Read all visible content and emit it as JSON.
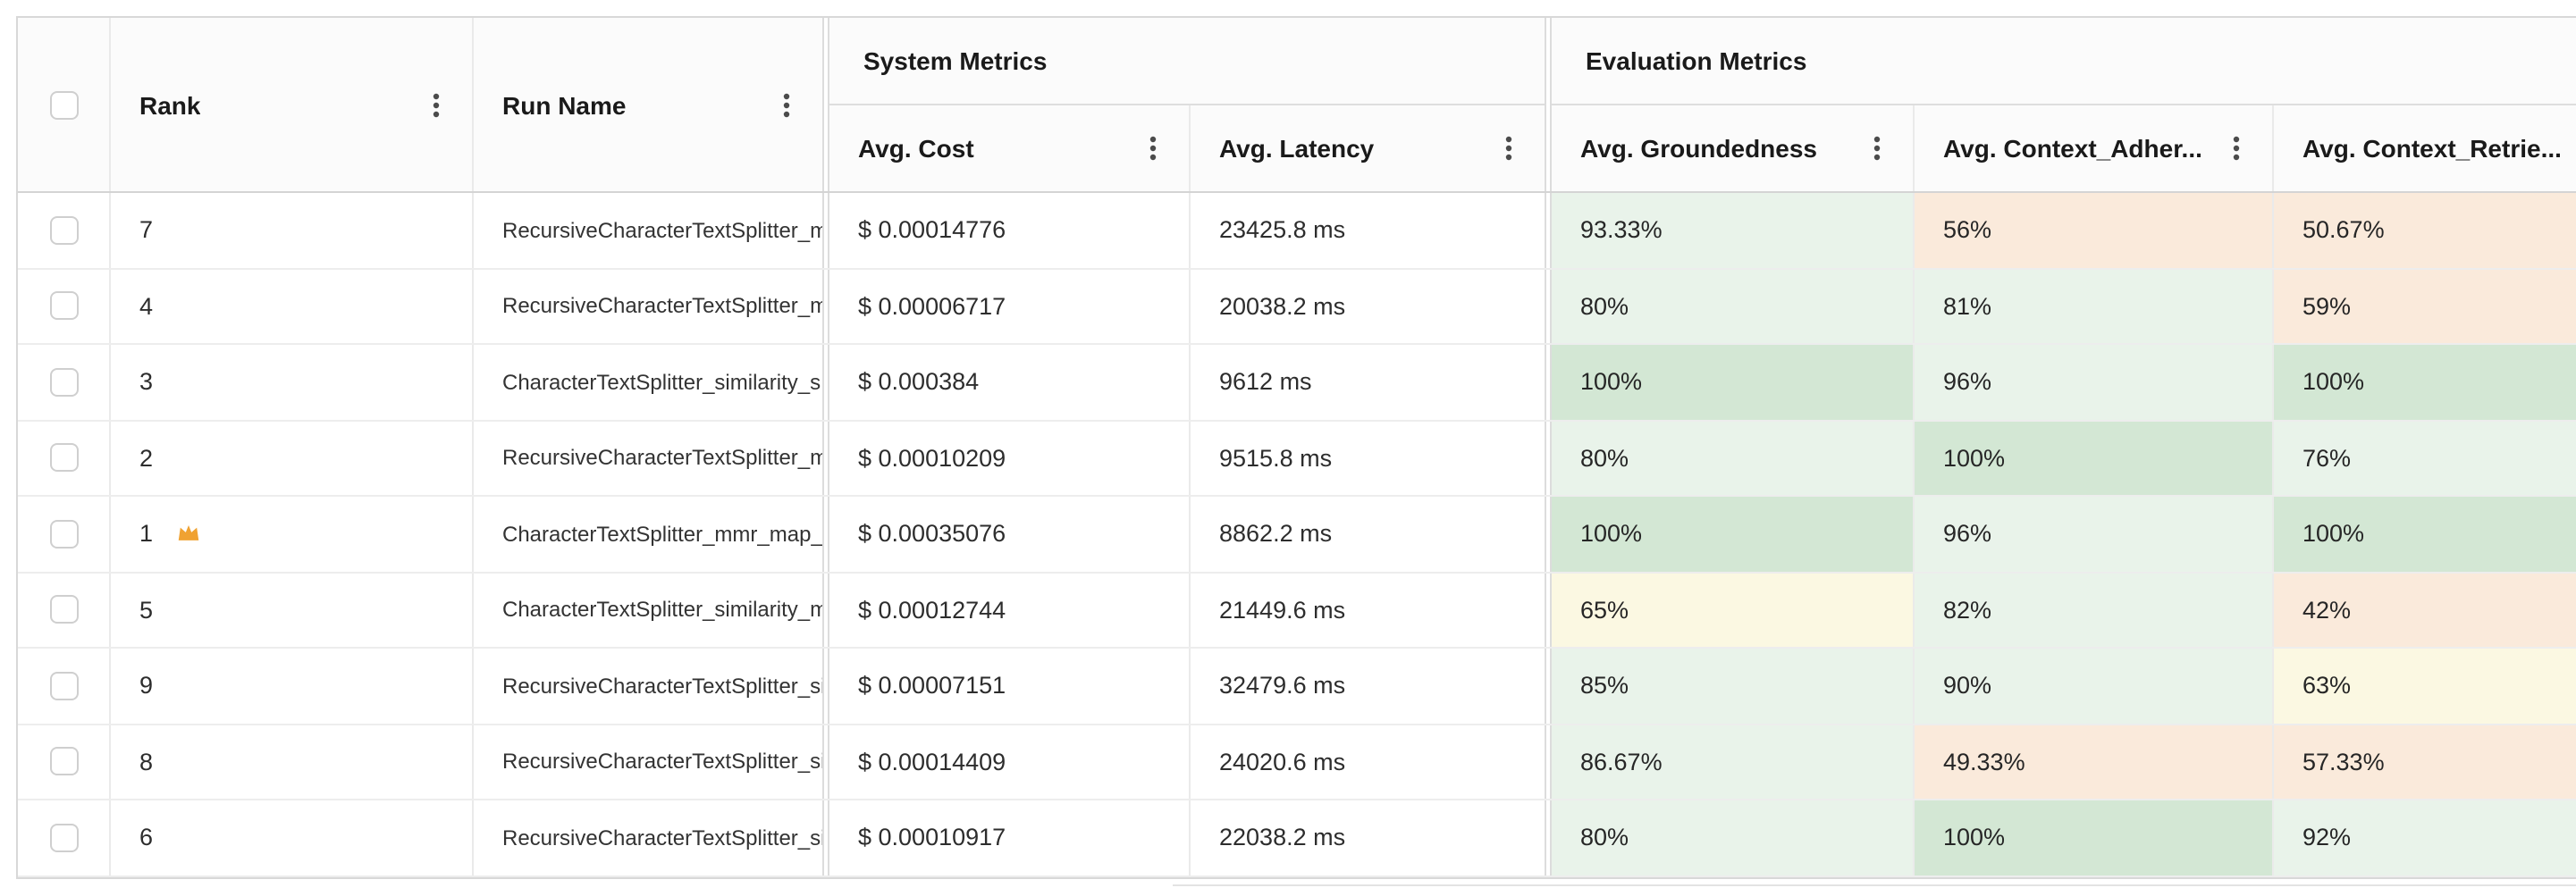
{
  "table": {
    "group_headers": {
      "system_metrics": "System Metrics",
      "evaluation_metrics": "Evaluation Metrics"
    },
    "columns": {
      "rank": "Rank",
      "run_name": "Run Name",
      "avg_cost": "Avg. Cost",
      "avg_latency": "Avg. Latency",
      "avg_groundedness": "Avg. Groundedness",
      "avg_context_adherence": "Avg. Context_Adher...",
      "avg_context_retrieval": "Avg. Context_Retrie..."
    },
    "tone_colors": {
      "green": "#d3e7d4",
      "green_light": "#e9f3ea",
      "yellow": "#fbf8e2",
      "orange": "#faeadb"
    },
    "rows": [
      {
        "rank": "7",
        "crown": false,
        "run_name": "RecursiveCharacterTextSplitter_m",
        "avg_cost": "$ 0.00014776",
        "avg_latency": "23425.8 ms",
        "groundedness": {
          "value": "93.33%",
          "tone": "green_light"
        },
        "adherence": {
          "value": "56%",
          "tone": "orange"
        },
        "retrieval": {
          "value": "50.67%",
          "tone": "orange"
        }
      },
      {
        "rank": "4",
        "crown": false,
        "run_name": "RecursiveCharacterTextSplitter_m",
        "avg_cost": "$ 0.00006717",
        "avg_latency": "20038.2 ms",
        "groundedness": {
          "value": "80%",
          "tone": "green_light"
        },
        "adherence": {
          "value": "81%",
          "tone": "green_light"
        },
        "retrieval": {
          "value": "59%",
          "tone": "orange"
        }
      },
      {
        "rank": "3",
        "crown": false,
        "run_name": "CharacterTextSplitter_similarity_s",
        "avg_cost": "$ 0.000384",
        "avg_latency": "9612 ms",
        "groundedness": {
          "value": "100%",
          "tone": "green"
        },
        "adherence": {
          "value": "96%",
          "tone": "green_light"
        },
        "retrieval": {
          "value": "100%",
          "tone": "green"
        }
      },
      {
        "rank": "2",
        "crown": false,
        "run_name": "RecursiveCharacterTextSplitter_m",
        "avg_cost": "$ 0.00010209",
        "avg_latency": "9515.8 ms",
        "groundedness": {
          "value": "80%",
          "tone": "green_light"
        },
        "adherence": {
          "value": "100%",
          "tone": "green"
        },
        "retrieval": {
          "value": "76%",
          "tone": "green_light"
        }
      },
      {
        "rank": "1",
        "crown": true,
        "run_name": "CharacterTextSplitter_mmr_map_",
        "avg_cost": "$ 0.00035076",
        "avg_latency": "8862.2 ms",
        "groundedness": {
          "value": "100%",
          "tone": "green"
        },
        "adherence": {
          "value": "96%",
          "tone": "green_light"
        },
        "retrieval": {
          "value": "100%",
          "tone": "green"
        }
      },
      {
        "rank": "5",
        "crown": false,
        "run_name": "CharacterTextSplitter_similarity_m",
        "avg_cost": "$ 0.00012744",
        "avg_latency": "21449.6 ms",
        "groundedness": {
          "value": "65%",
          "tone": "yellow"
        },
        "adherence": {
          "value": "82%",
          "tone": "green_light"
        },
        "retrieval": {
          "value": "42%",
          "tone": "orange"
        }
      },
      {
        "rank": "9",
        "crown": false,
        "run_name": "RecursiveCharacterTextSplitter_si",
        "avg_cost": "$ 0.00007151",
        "avg_latency": "32479.6 ms",
        "groundedness": {
          "value": "85%",
          "tone": "green_light"
        },
        "adherence": {
          "value": "90%",
          "tone": "green_light"
        },
        "retrieval": {
          "value": "63%",
          "tone": "yellow"
        }
      },
      {
        "rank": "8",
        "crown": false,
        "run_name": "RecursiveCharacterTextSplitter_si",
        "avg_cost": "$ 0.00014409",
        "avg_latency": "24020.6 ms",
        "groundedness": {
          "value": "86.67%",
          "tone": "green_light"
        },
        "adherence": {
          "value": "49.33%",
          "tone": "orange"
        },
        "retrieval": {
          "value": "57.33%",
          "tone": "orange"
        }
      },
      {
        "rank": "6",
        "crown": false,
        "run_name": "RecursiveCharacterTextSplitter_si",
        "avg_cost": "$ 0.00010917",
        "avg_latency": "22038.2 ms",
        "groundedness": {
          "value": "80%",
          "tone": "green_light"
        },
        "adherence": {
          "value": "100%",
          "tone": "green"
        },
        "retrieval": {
          "value": "92%",
          "tone": "green_light"
        }
      }
    ]
  }
}
